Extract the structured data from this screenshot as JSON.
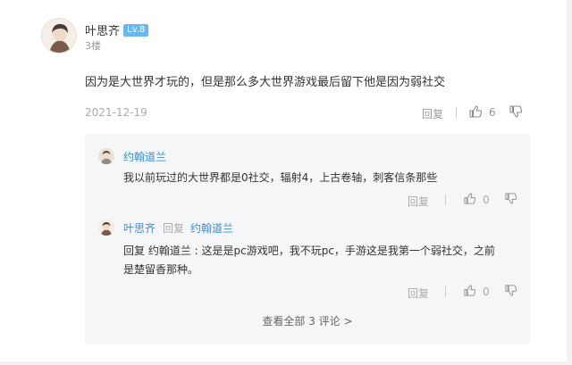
{
  "comment": {
    "username": "叶思齐",
    "level": "Lv.8",
    "floor": "3楼",
    "text": "因为是大世界才玩的，但是那么多大世界游戏最后留下他是因为弱社交",
    "date": "2021-12-19",
    "reply_label": "回复",
    "like_count": "6"
  },
  "replies": [
    {
      "username": "约翰道兰",
      "text": "我以前玩过的大世界都是0社交，辐射4，上古卷轴，刺客信条那些",
      "reply_label": "回复",
      "like_count": "0"
    },
    {
      "username": "叶思齐",
      "reply_word": "回复",
      "reply_to": "约翰道兰",
      "text_line1": "回复 约翰道兰 : 这是是pc游戏吧，我不玩pc，手游这是我第一个弱社交，之前",
      "text_line2": "是楚留香那种。",
      "reply_label": "回复",
      "like_count": "0"
    }
  ],
  "view_all": "查看全部 3 评论 >",
  "icons": {
    "like": "thumbs-up-icon",
    "dislike": "thumbs-down-icon"
  },
  "colors": {
    "link_blue": "#3b8ede",
    "badge_blue": "#6ab7ef",
    "reply_bg": "#f5f6f7"
  }
}
